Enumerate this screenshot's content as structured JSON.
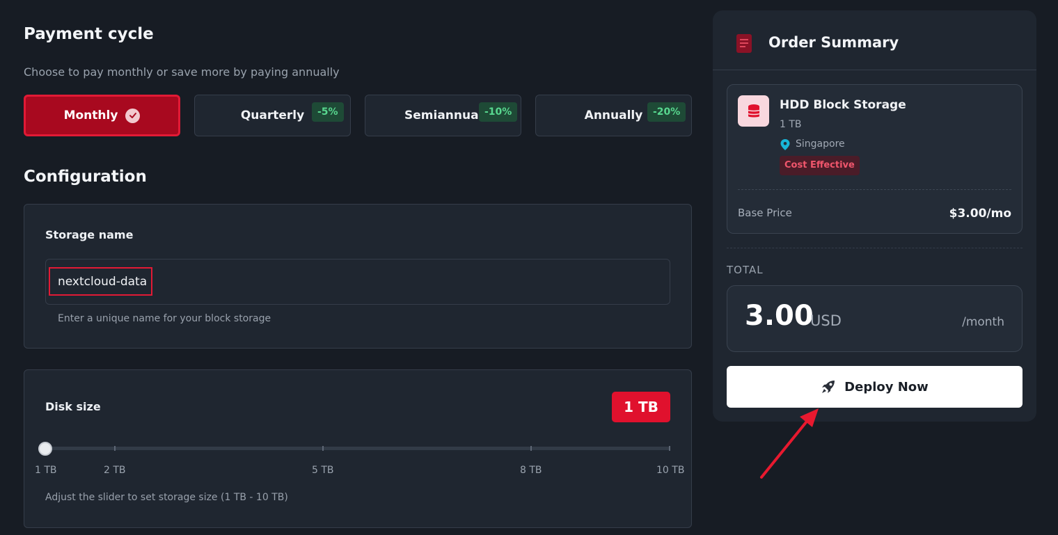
{
  "payment": {
    "title": "Payment cycle",
    "subtitle": "Choose to pay monthly or save more by paying annually",
    "options": [
      {
        "label": "Monthly",
        "discount": ""
      },
      {
        "label": "Quarterly",
        "discount": "-5%"
      },
      {
        "label": "Semiannually",
        "discount": "-10%"
      },
      {
        "label": "Annually",
        "discount": "-20%"
      }
    ],
    "selected": "Monthly"
  },
  "configuration": {
    "title": "Configuration",
    "storage_name": {
      "label": "Storage name",
      "value": "nextcloud-data",
      "hint": "Enter a unique name for your block storage"
    },
    "disk_size": {
      "label": "Disk size",
      "value": "1 TB",
      "ticks": [
        "1 TB",
        "2 TB",
        "5 TB",
        "8 TB",
        "10 TB"
      ],
      "hint": "Adjust the slider to set storage size (1 TB - 10 TB)"
    }
  },
  "summary": {
    "title": "Order Summary",
    "item": {
      "name": "HDD Block Storage",
      "size": "1 TB",
      "location": "Singapore",
      "tag": "Cost Effective"
    },
    "base_price_label": "Base Price",
    "base_price_value": "$3.00/mo",
    "total_label": "TOTAL",
    "total_amount": "3.00",
    "total_currency": "USD",
    "total_period": "/month",
    "deploy_label": "Deploy Now"
  },
  "colors": {
    "accent": "#e0112d",
    "background": "#171c24",
    "card": "#1f2630",
    "discount_text": "#58d78f",
    "annotation_arrow": "#e8192f"
  },
  "icons": [
    "check-icon",
    "document-icon",
    "database-icon",
    "location-pin-icon",
    "rocket-icon"
  ]
}
